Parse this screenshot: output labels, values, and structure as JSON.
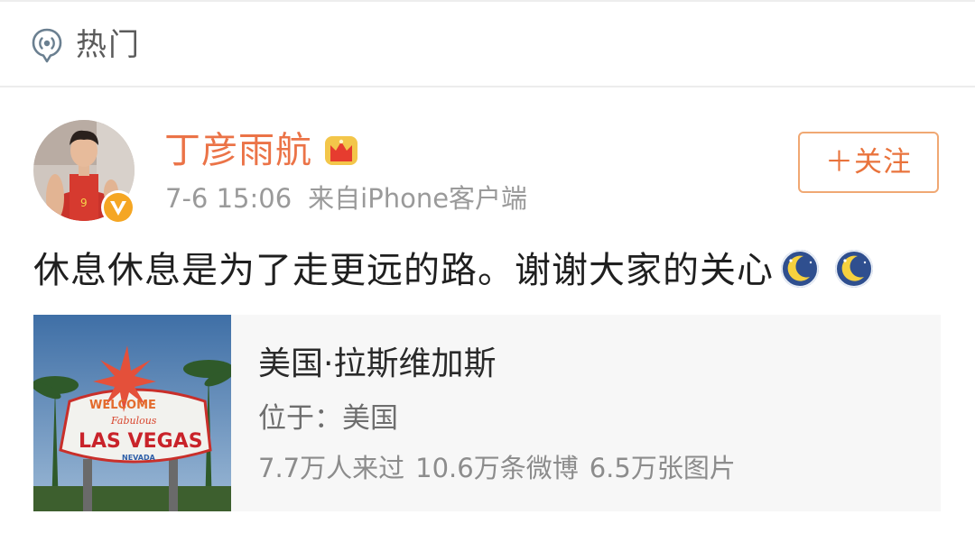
{
  "header": {
    "title": "热门",
    "icon": "hot-topic-icon"
  },
  "post": {
    "user": {
      "name": "丁彦雨航",
      "verified_badge": "v-verified-icon",
      "member_icon": "crown-icon",
      "avatar": "avatar-photo"
    },
    "time": "7-6 15:06",
    "source": "来自iPhone客户端",
    "follow_label": "＋关注",
    "text": "休息休息是为了走更远的路。谢谢大家的关心",
    "emojis": [
      "moon-sleep-emoji",
      "moon-sleep-emoji"
    ],
    "location": {
      "name": "美国·拉斯维加斯",
      "located_in": "位于：美国",
      "visitors": "7.7万人来过",
      "posts": "10.6万条微博",
      "photos": "6.5万张图片",
      "image": "las-vegas-sign-photo"
    }
  },
  "colors": {
    "username": "#eb7347",
    "follow_border": "#f0a873",
    "follow_text": "#e9733c",
    "card_bg": "#f7f7f7"
  }
}
